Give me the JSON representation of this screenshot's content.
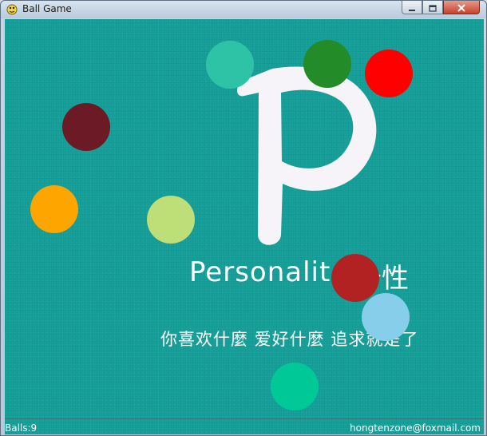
{
  "window": {
    "title": "Ball Game",
    "icon": "pygame-snake-icon",
    "controls": {
      "minimize": "minimize-icon",
      "maximize": "maximize-icon",
      "close": "close-icon"
    }
  },
  "background": {
    "color": "#17a09a",
    "logo_letter": "P",
    "brand_text": "Personalit",
    "brand_cjk": "个性",
    "slogan": "你喜欢什麼  爱好什麼  追求就是了"
  },
  "balls": [
    {
      "color": "#2ec3a6"
    },
    {
      "color": "#238b28"
    },
    {
      "color": "#ff0000"
    },
    {
      "color": "#6b1a26"
    },
    {
      "color": "#ffa500"
    },
    {
      "color": "#bede78"
    },
    {
      "color": "#b22222"
    },
    {
      "color": "#87ceeb"
    },
    {
      "color": "#00c896"
    }
  ],
  "status": {
    "balls_label": "Balls:9",
    "email": "hongtenzone@foxmail.com"
  }
}
